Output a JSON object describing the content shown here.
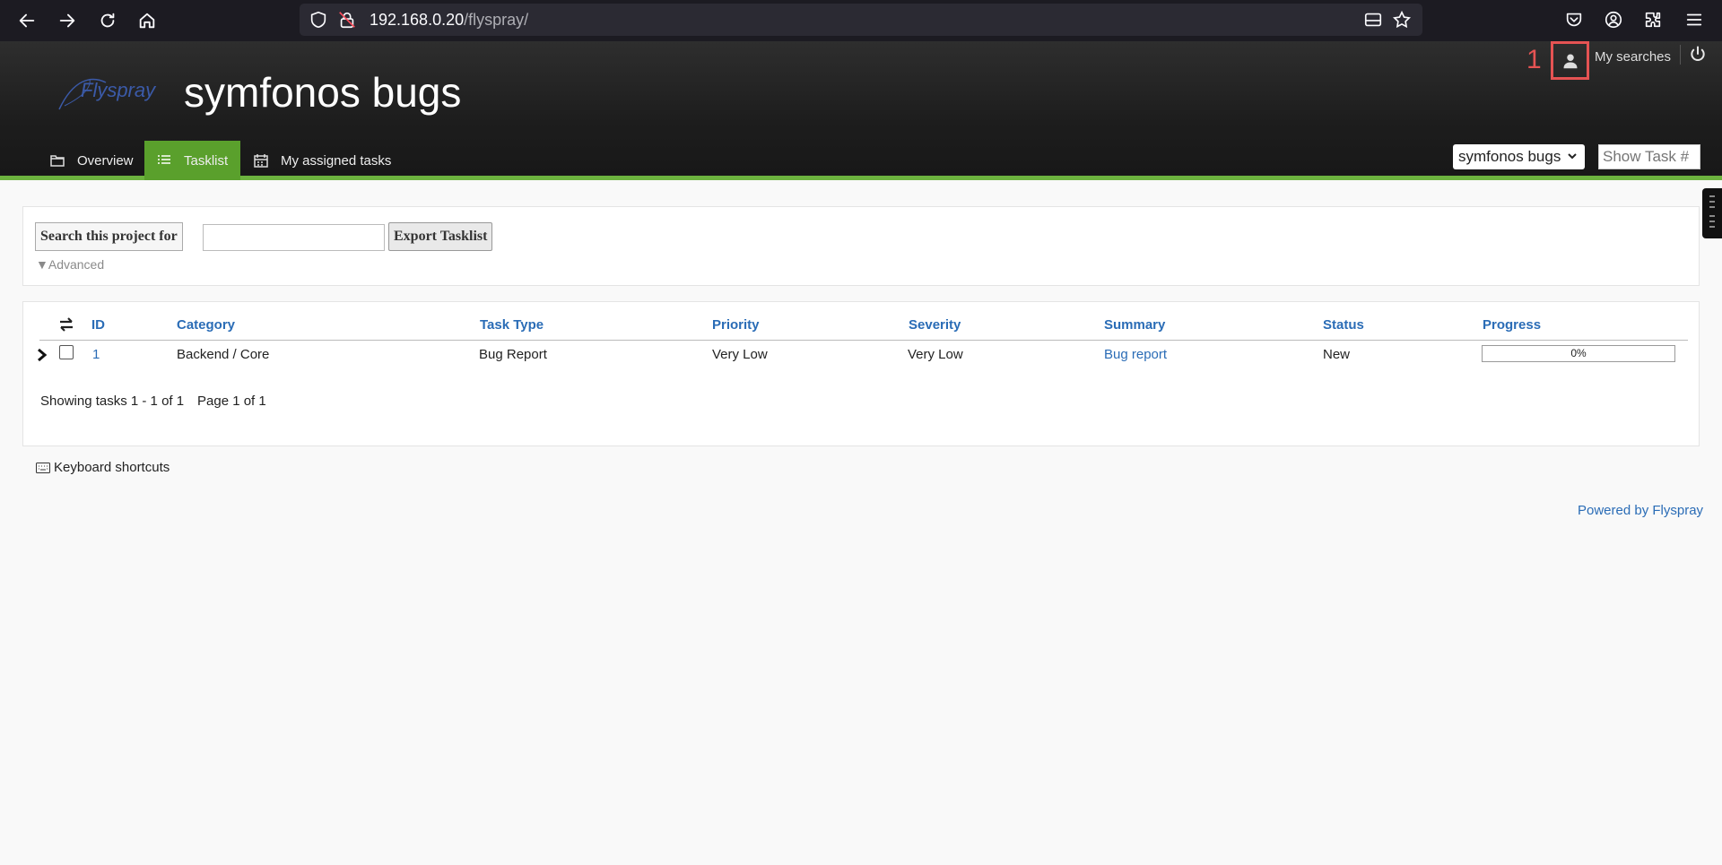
{
  "browser": {
    "url_host": "192.168.0.20",
    "url_path": "/flyspray/"
  },
  "header": {
    "logo_text": "Flyspray",
    "project_title": "symfonos bugs",
    "annotation_number": "1",
    "my_searches": "My searches"
  },
  "tabs": [
    {
      "label": "Overview",
      "icon": "folder-icon"
    },
    {
      "label": "Tasklist",
      "icon": "list-icon",
      "active": true
    },
    {
      "label": "My assigned tasks",
      "icon": "calendar-icon"
    }
  ],
  "project_select": {
    "value": "symfonos bugs"
  },
  "show_task": {
    "placeholder": "Show Task #"
  },
  "search": {
    "label": "Search this project for",
    "value": "",
    "export_label": "Export Tasklist",
    "advanced_label": "▼Advanced"
  },
  "table": {
    "columns": [
      "ID",
      "Category",
      "Task Type",
      "Priority",
      "Severity",
      "Summary",
      "Status",
      "Progress"
    ],
    "rows": [
      {
        "id": "1",
        "category": "Backend / Core",
        "task_type": "Bug Report",
        "priority": "Very Low",
        "severity": "Very Low",
        "summary": "Bug report",
        "status": "New",
        "progress": 0,
        "progress_label": "0%"
      }
    ],
    "showing": "Showing tasks 1 - 1 of 1",
    "page": "Page 1 of 1"
  },
  "footer": {
    "keyboard_shortcuts": "Keyboard shortcuts",
    "powered_by": "Powered by Flyspray"
  },
  "colors": {
    "accent_green": "#5aa02c",
    "link_blue": "#2a6cb6",
    "annotation_red": "#e55353"
  }
}
